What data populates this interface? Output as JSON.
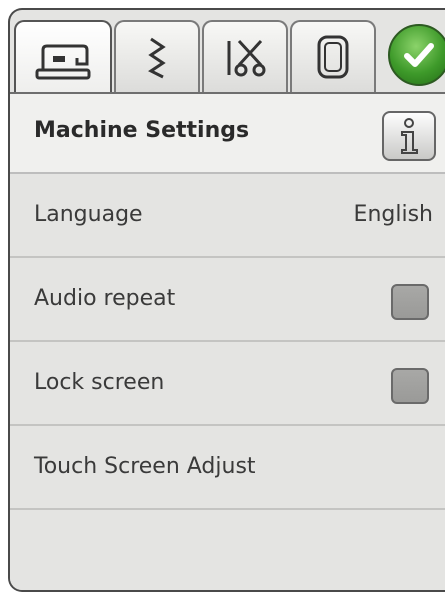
{
  "tabs": [
    {
      "icon": "sewing-machine-icon",
      "active": true
    },
    {
      "icon": "zigzag-stitch-icon",
      "active": false
    },
    {
      "icon": "scissors-icon",
      "active": false
    },
    {
      "icon": "hoop-icon",
      "active": false
    }
  ],
  "confirm": {
    "icon": "checkmark-icon",
    "color": "#3e9a2a"
  },
  "header": {
    "title": "Machine Settings",
    "info_icon": "info-icon"
  },
  "settings": [
    {
      "label": "Language",
      "value": "English"
    },
    {
      "label": "Audio repeat",
      "checked": false
    },
    {
      "label": "Lock screen",
      "checked": false
    },
    {
      "label": "Touch Screen Adjust"
    }
  ]
}
